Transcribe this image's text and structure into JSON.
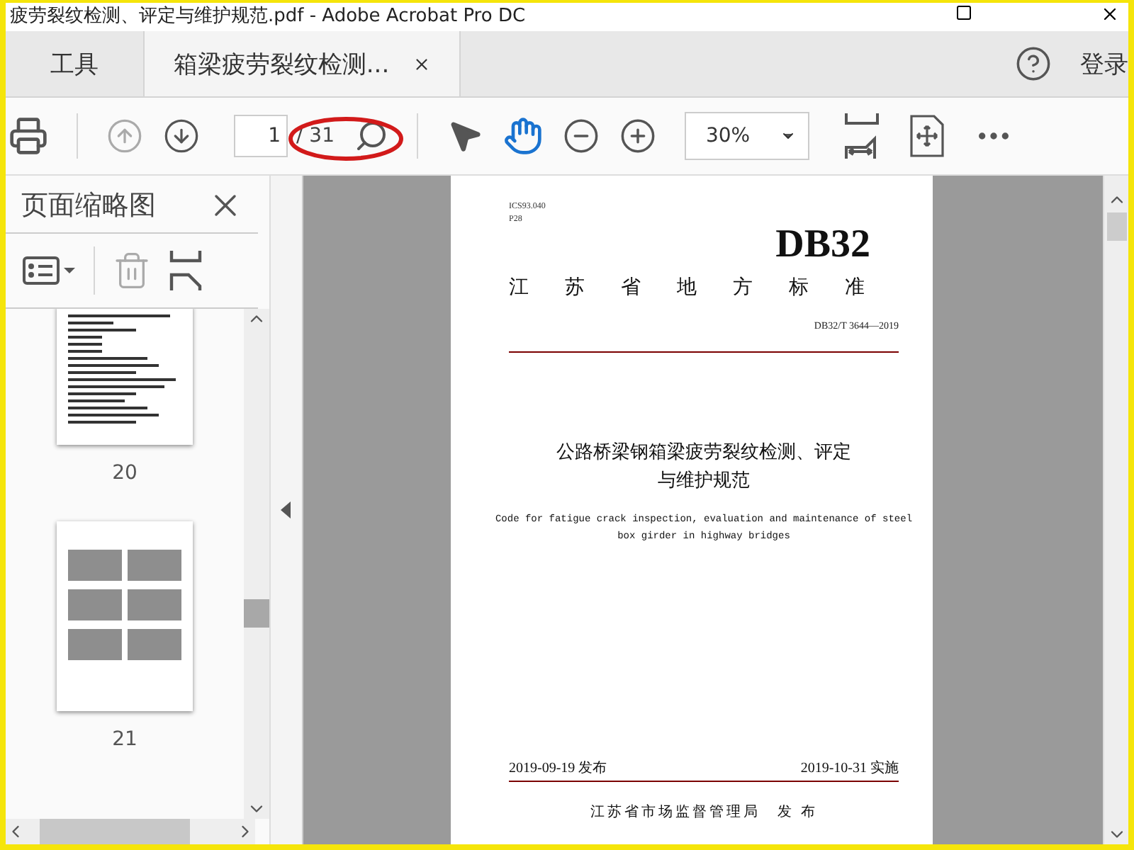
{
  "window": {
    "title": "疲劳裂纹检测、评定与维护规范.pdf - Adobe Acrobat Pro DC"
  },
  "tabs": [
    {
      "label": "工具",
      "kind": "home",
      "selected": false
    },
    {
      "label": "箱梁疲劳裂纹检测...",
      "kind": "document",
      "selected": true
    }
  ],
  "header": {
    "login": "登录"
  },
  "toolbar": {
    "page_number": "1",
    "page_total": "/ 31",
    "zoom": "30%"
  },
  "sidebar": {
    "title": "页面缩略图",
    "thumbnails": [
      {
        "page": "20",
        "kind": "text"
      },
      {
        "page": "21",
        "kind": "photos"
      }
    ]
  },
  "document": {
    "ics": "ICS93.040",
    "category": "P28",
    "code": "DB32",
    "heading": "江 苏 省 地 方 标 准",
    "number": "DB32/T 3644—2019",
    "title_lines": [
      "公路桥梁钢箱梁疲劳裂纹检测、评定",
      "与维护规范"
    ],
    "english_lines": [
      "Code for fatigue crack inspection, evaluation and maintenance of steel",
      "box girder in highway bridges"
    ],
    "released": "2019-09-19 发布",
    "implemented": "2019-10-31 实施",
    "publisher": "江苏省市场监督管理局　发 布"
  }
}
